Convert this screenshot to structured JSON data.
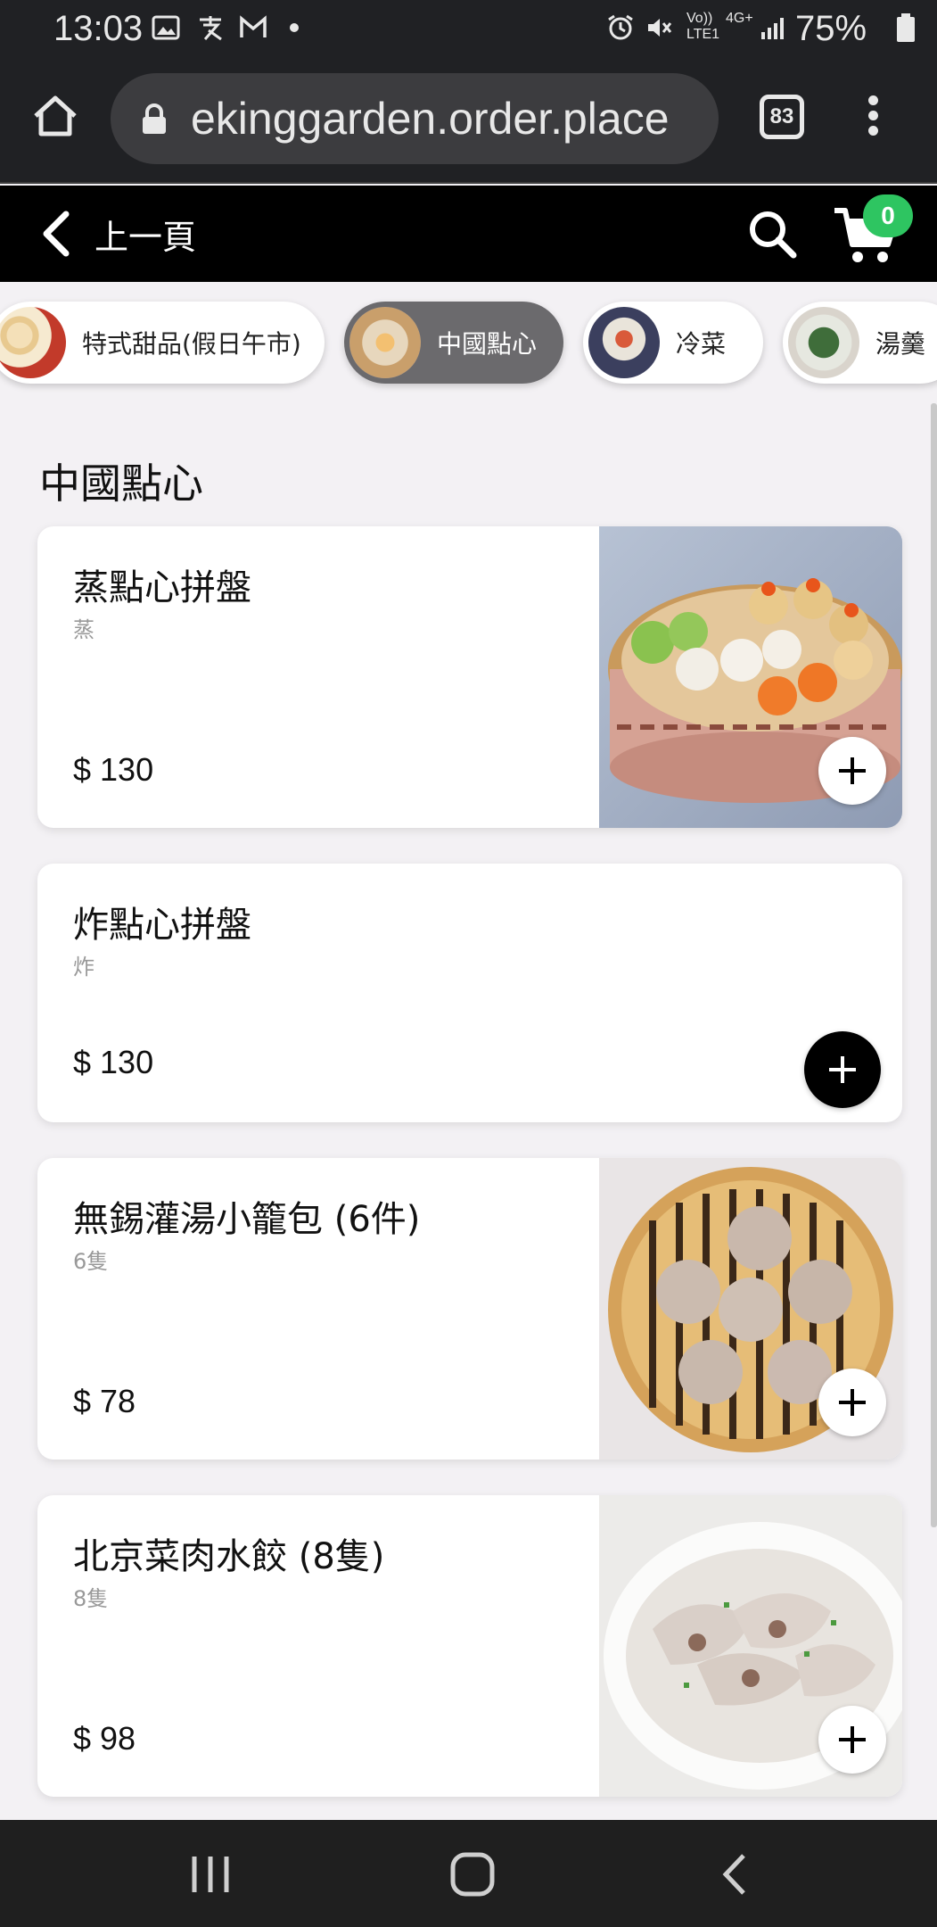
{
  "status": {
    "time": "13:03",
    "battery": "75%",
    "network": "4G+",
    "network_sub": "LTE1",
    "volte": "Vo))"
  },
  "browser": {
    "url": "ekinggarden.order.place",
    "tab_count": "83"
  },
  "header": {
    "back_label": "上一頁",
    "cart_count": "0"
  },
  "categories": [
    {
      "label": "特式甜品(假日午市)",
      "active": false
    },
    {
      "label": "中國點心",
      "active": true
    },
    {
      "label": "冷菜",
      "active": false
    },
    {
      "label": "湯羹",
      "active": false
    }
  ],
  "section": {
    "title": "中國點心"
  },
  "items": [
    {
      "name": "蒸點心拼盤",
      "sub": "蒸",
      "price": "$ 130"
    },
    {
      "name": "炸點心拼盤",
      "sub": "炸",
      "price": "$ 130"
    },
    {
      "name": "無錫灌湯小籠包 (6件)",
      "sub": "6隻",
      "price": "$ 78"
    },
    {
      "name": "北京菜肉水餃 (8隻)",
      "sub": "8隻",
      "price": "$ 98"
    }
  ],
  "colors": {
    "badge_green": "#2ec561",
    "active_chip": "#6b6a6d",
    "header_bg": "#000000",
    "browser_bg": "#202124"
  },
  "icons": [
    "home-icon",
    "lock-icon",
    "tabs-icon",
    "more-vert-icon",
    "back-chevron-icon",
    "search-icon",
    "cart-icon",
    "plus-icon",
    "recents-icon",
    "home-nav-icon",
    "back-nav-icon"
  ]
}
